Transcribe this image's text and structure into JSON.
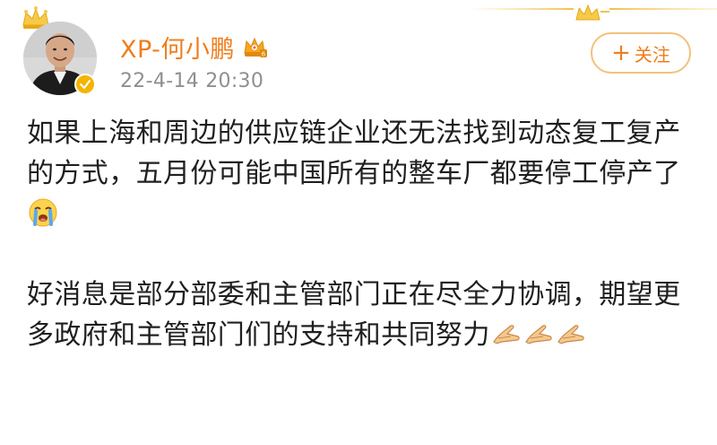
{
  "post": {
    "author": {
      "name": "XP-何小鹏",
      "avatar_icon": "user-avatar-icon",
      "verified_icon": "verified-badge-icon",
      "vip_icon": "vip-crown-icon",
      "accent_color": "#ef7d1c"
    },
    "timestamp": "22-4-14 20:30",
    "follow_button": {
      "plus": "+",
      "label": "关注"
    },
    "paragraphs": [
      {
        "text": "如果上海和周边的供应链企业还无法找到动态复工复产的方式，五月份可能中国所有的整车厂都要停工停产了",
        "emojis": [
          "crying-face-icon"
        ]
      },
      {
        "text": "好消息是部分部委和主管部门正在尽全力协调，期望更多政府和主管部门们的支持和共同努力",
        "emojis": [
          "pray-hands-icon",
          "pray-hands-icon",
          "pray-hands-icon"
        ]
      }
    ]
  }
}
